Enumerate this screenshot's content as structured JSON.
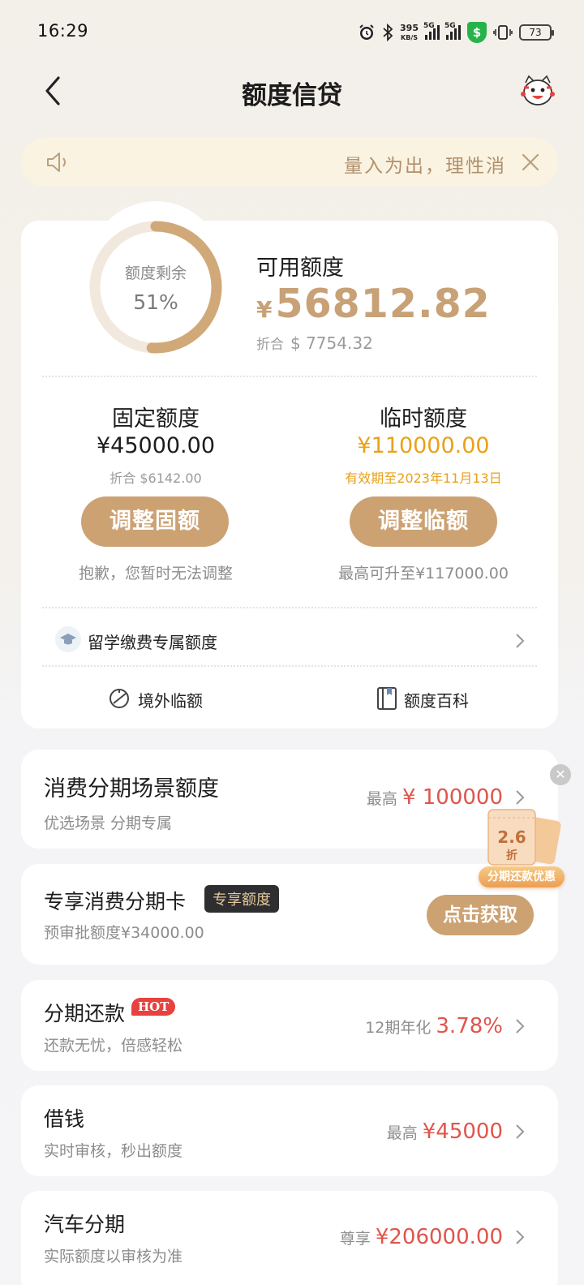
{
  "status_bar": {
    "time": "16:29",
    "net_speed": "395",
    "net_unit": "KB/S",
    "signal1_label": "5G",
    "signal2_label": "5G",
    "battery": "73",
    "icons": [
      "alarm-icon",
      "bluetooth-icon",
      "signal-icon",
      "signal-icon",
      "security-shield-icon",
      "vibrate-icon",
      "battery-icon"
    ]
  },
  "nav": {
    "title": "额度信贷"
  },
  "notice": {
    "text": "量入为出，理性消"
  },
  "limit": {
    "ring_label": "额度剩余",
    "ring_percent": "51%",
    "ring_fraction": 0.51,
    "available_label": "可用额度",
    "currency_symbol": "¥",
    "available_amount": "56812.82",
    "equiv_prefix": "折合",
    "equiv_amount": "$ 7754.32"
  },
  "fixed": {
    "title": "固定额度",
    "amount": "¥45000.00",
    "equiv": "折合 $6142.00",
    "button": "调整固额",
    "note": "抱歉，您暂时无法调整"
  },
  "temporary": {
    "title": "临时额度",
    "amount": "¥110000.00",
    "valid": "有效期至2023年11月13日",
    "button": "调整临额",
    "note": "最高可升至¥117000.00"
  },
  "study": {
    "label": "留学缴费专属额度"
  },
  "tools": {
    "overseas": "境外临额",
    "wiki": "额度百科"
  },
  "cards": {
    "scene": {
      "title": "消费分期场景额度",
      "sub": "优选场景 分期专属",
      "prefix": "最高",
      "value": "¥ 100000"
    },
    "exclusive": {
      "title": "专享消费分期卡",
      "tag": "专享额度",
      "sub": "预审批额度¥34000.00",
      "button": "点击获取"
    },
    "installment": {
      "title": "分期还款",
      "badge": "HOT",
      "sub": "还款无忧，倍感轻松",
      "prefix": "12期年化",
      "value": "3.78%"
    },
    "borrow": {
      "title": "借钱",
      "sub": "实时审核，秒出额度",
      "prefix": "最高",
      "value": "¥45000"
    },
    "car": {
      "title": "汽车分期",
      "sub": "实际额度以审核为准",
      "prefix": "尊享",
      "value": "¥206000.00"
    }
  },
  "promo": {
    "discount": "2.6",
    "unit": "折",
    "label": "分期还款优惠"
  },
  "colors": {
    "gold": "#cca273",
    "amount_gold": "#c8a177",
    "temp_amount": "#e8a11a",
    "red": "#e0554c"
  }
}
